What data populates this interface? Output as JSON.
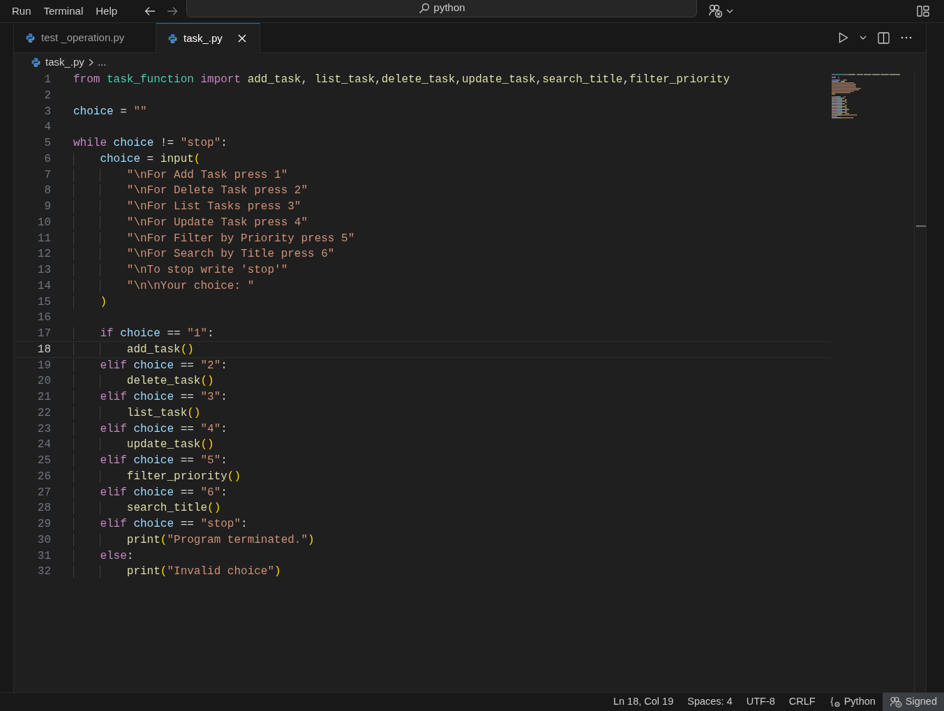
{
  "menu": [
    "Run",
    "Terminal",
    "Help"
  ],
  "search": {
    "text": "python"
  },
  "tabs": [
    {
      "label": "test _operation.py",
      "selected": false
    },
    {
      "label": "task_.py",
      "selected": true
    }
  ],
  "breadcrumb": [
    "task_.py",
    "..."
  ],
  "editor": {
    "lines": [
      {
        "number": "1",
        "current": false,
        "tokens": [
          {
            "kind": "keyword",
            "text": "from"
          },
          {
            "kind": "module",
            "text": " task_function"
          },
          {
            "kind": "keyword",
            "text": " import"
          },
          {
            "kind": "function",
            "text": " add_task"
          },
          {
            "kind": "plain",
            "text": ", "
          },
          {
            "kind": "function",
            "text": "list_task"
          },
          {
            "kind": "plain",
            "text": ","
          },
          {
            "kind": "function",
            "text": "delete_task"
          },
          {
            "kind": "plain",
            "text": ","
          },
          {
            "kind": "function",
            "text": "update_task"
          },
          {
            "kind": "plain",
            "text": ","
          },
          {
            "kind": "function",
            "text": "search_title"
          },
          {
            "kind": "plain",
            "text": ","
          },
          {
            "kind": "function",
            "text": "filter_priority"
          }
        ]
      },
      {
        "number": "2",
        "current": false
      },
      {
        "number": "3",
        "current": false,
        "tokens": [
          {
            "kind": "variable",
            "text": "choice"
          },
          {
            "kind": "plain",
            "text": " = "
          },
          {
            "kind": "string",
            "text": "\"\""
          }
        ]
      },
      {
        "number": "4",
        "current": false
      },
      {
        "number": "5",
        "current": false,
        "tokens": [
          {
            "kind": "keyword",
            "text": "while"
          },
          {
            "kind": "variable",
            "text": " choice"
          },
          {
            "kind": "plain",
            "text": " != "
          },
          {
            "kind": "string",
            "text": "\"stop\""
          },
          {
            "kind": "plain",
            "text": ":"
          }
        ]
      },
      {
        "number": "6",
        "current": false,
        "tokens": [
          {
            "kind": "variable",
            "text": "    choice"
          },
          {
            "kind": "plain",
            "text": " = "
          },
          {
            "kind": "function",
            "text": "input"
          },
          {
            "kind": "bracket",
            "text": "("
          }
        ]
      },
      {
        "number": "7",
        "current": false,
        "tokens": [
          {
            "kind": "string",
            "text": "        \"\\nFor Add Task press 1\""
          }
        ]
      },
      {
        "number": "8",
        "current": false,
        "tokens": [
          {
            "kind": "string",
            "text": "        \"\\nFor Delete Task press 2\""
          }
        ]
      },
      {
        "number": "9",
        "current": false,
        "tokens": [
          {
            "kind": "string",
            "text": "        \"\\nFor List Tasks press 3\""
          }
        ]
      },
      {
        "number": "10",
        "current": false,
        "tokens": [
          {
            "kind": "string",
            "text": "        \"\\nFor Update Task press 4\""
          }
        ]
      },
      {
        "number": "11",
        "current": false,
        "tokens": [
          {
            "kind": "string",
            "text": "        \"\\nFor Filter by Priority press 5\""
          }
        ]
      },
      {
        "number": "12",
        "current": false,
        "tokens": [
          {
            "kind": "string",
            "text": "        \"\\nFor Search by Title press 6\""
          }
        ]
      },
      {
        "number": "13",
        "current": false,
        "tokens": [
          {
            "kind": "string",
            "text": "        \"\\nTo stop write 'stop'\""
          }
        ]
      },
      {
        "number": "14",
        "current": false,
        "tokens": [
          {
            "kind": "string",
            "text": "        \"\\n\\nYour choice: \""
          }
        ]
      },
      {
        "number": "15",
        "current": false,
        "tokens": [
          {
            "kind": "bracket",
            "text": "    )"
          }
        ]
      },
      {
        "number": "16",
        "current": false
      },
      {
        "number": "17",
        "current": false,
        "tokens": [
          {
            "kind": "keyword",
            "text": "    if"
          },
          {
            "kind": "variable",
            "text": " choice"
          },
          {
            "kind": "plain",
            "text": " == "
          },
          {
            "kind": "string",
            "text": "\"1\""
          },
          {
            "kind": "plain",
            "text": ":"
          }
        ]
      },
      {
        "number": "18",
        "current": true,
        "tokens": [
          {
            "kind": "function",
            "text": "        add_task"
          },
          {
            "kind": "bracket",
            "text": "()"
          }
        ]
      },
      {
        "number": "19",
        "current": false,
        "tokens": [
          {
            "kind": "keyword",
            "text": "    elif"
          },
          {
            "kind": "variable",
            "text": " choice"
          },
          {
            "kind": "plain",
            "text": " == "
          },
          {
            "kind": "string",
            "text": "\"2\""
          },
          {
            "kind": "plain",
            "text": ":"
          }
        ]
      },
      {
        "number": "20",
        "current": false,
        "tokens": [
          {
            "kind": "function",
            "text": "        delete_task"
          },
          {
            "kind": "bracket",
            "text": "()"
          }
        ]
      },
      {
        "number": "21",
        "current": false,
        "tokens": [
          {
            "kind": "keyword",
            "text": "    elif"
          },
          {
            "kind": "variable",
            "text": " choice"
          },
          {
            "kind": "plain",
            "text": " == "
          },
          {
            "kind": "string",
            "text": "\"3\""
          },
          {
            "kind": "plain",
            "text": ":"
          }
        ]
      },
      {
        "number": "22",
        "current": false,
        "tokens": [
          {
            "kind": "function",
            "text": "        list_task"
          },
          {
            "kind": "bracket",
            "text": "()"
          }
        ]
      },
      {
        "number": "23",
        "current": false,
        "tokens": [
          {
            "kind": "keyword",
            "text": "    elif"
          },
          {
            "kind": "variable",
            "text": " choice"
          },
          {
            "kind": "plain",
            "text": " == "
          },
          {
            "kind": "string",
            "text": "\"4\""
          },
          {
            "kind": "plain",
            "text": ":"
          }
        ]
      },
      {
        "number": "24",
        "current": false,
        "tokens": [
          {
            "kind": "function",
            "text": "        update_task"
          },
          {
            "kind": "bracket",
            "text": "()"
          }
        ]
      },
      {
        "number": "25",
        "current": false,
        "tokens": [
          {
            "kind": "keyword",
            "text": "    elif"
          },
          {
            "kind": "variable",
            "text": " choice"
          },
          {
            "kind": "plain",
            "text": " == "
          },
          {
            "kind": "string",
            "text": "\"5\""
          },
          {
            "kind": "plain",
            "text": ":"
          }
        ]
      },
      {
        "number": "26",
        "current": false,
        "tokens": [
          {
            "kind": "function",
            "text": "        filter_priority"
          },
          {
            "kind": "bracket",
            "text": "()"
          }
        ]
      },
      {
        "number": "27",
        "current": false,
        "tokens": [
          {
            "kind": "keyword",
            "text": "    elif"
          },
          {
            "kind": "variable",
            "text": " choice"
          },
          {
            "kind": "plain",
            "text": " == "
          },
          {
            "kind": "string",
            "text": "\"6\""
          },
          {
            "kind": "plain",
            "text": ":"
          }
        ]
      },
      {
        "number": "28",
        "current": false,
        "tokens": [
          {
            "kind": "function",
            "text": "        search_title"
          },
          {
            "kind": "bracket",
            "text": "()"
          }
        ]
      },
      {
        "number": "29",
        "current": false,
        "tokens": [
          {
            "kind": "keyword",
            "text": "    elif"
          },
          {
            "kind": "variable",
            "text": " choice"
          },
          {
            "kind": "plain",
            "text": " == "
          },
          {
            "kind": "string",
            "text": "\"stop\""
          },
          {
            "kind": "plain",
            "text": ":"
          }
        ]
      },
      {
        "number": "30",
        "current": false,
        "tokens": [
          {
            "kind": "function",
            "text": "        print"
          },
          {
            "kind": "bracket",
            "text": "("
          },
          {
            "kind": "string",
            "text": "\"Program terminated.\""
          },
          {
            "kind": "bracket",
            "text": ")"
          }
        ]
      },
      {
        "number": "31",
        "current": false,
        "tokens": [
          {
            "kind": "keyword",
            "text": "    else"
          },
          {
            "kind": "plain",
            "text": ":"
          }
        ]
      },
      {
        "number": "32",
        "current": false,
        "tokens": [
          {
            "kind": "function",
            "text": "        print"
          },
          {
            "kind": "bracket",
            "text": "("
          },
          {
            "kind": "string",
            "text": "\"Invalid choice\""
          },
          {
            "kind": "bracket",
            "text": ")"
          }
        ]
      }
    ]
  },
  "status_bar": [
    {
      "kind": "text",
      "text": "Ln 18, Col 19"
    },
    {
      "kind": "text",
      "text": "Spaces: 4"
    },
    {
      "kind": "text",
      "text": "UTF-8"
    },
    {
      "kind": "text",
      "text": "CRLF"
    },
    {
      "kind": "language",
      "text": "Python"
    },
    {
      "kind": "account",
      "text": "Signed"
    }
  ]
}
